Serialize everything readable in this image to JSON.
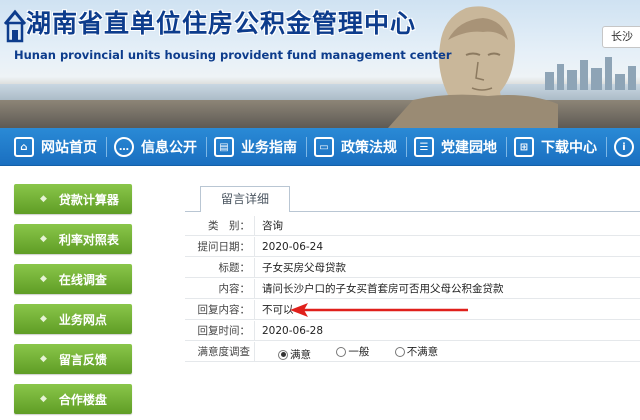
{
  "header": {
    "title_cn": "湖南省直单位住房公积金管理中心",
    "title_en": "Hunan provincial units housing provident fund management center",
    "city": "长沙"
  },
  "nav": {
    "items": [
      {
        "label": "网站首页",
        "icon": "home-icon"
      },
      {
        "label": "信息公开",
        "icon": "chat-icon"
      },
      {
        "label": "业务指南",
        "icon": "book-icon"
      },
      {
        "label": "政策法规",
        "icon": "doc-icon"
      },
      {
        "label": "党建园地",
        "icon": "party-icon"
      },
      {
        "label": "下载中心",
        "icon": "grid-icon"
      },
      {
        "label": "",
        "icon": "info-icon"
      }
    ]
  },
  "sidebar": {
    "items": [
      {
        "label": "贷款计算器"
      },
      {
        "label": "利率对照表"
      },
      {
        "label": "在线调查"
      },
      {
        "label": "业务网点"
      },
      {
        "label": "留言反馈"
      },
      {
        "label": "合作楼盘"
      }
    ]
  },
  "detail": {
    "tab": "留言详细",
    "rows": [
      {
        "label": "类　别：",
        "value": "咨询"
      },
      {
        "label": "提问日期：",
        "value": "2020-06-24"
      },
      {
        "label": "标题：",
        "value": "子女买房父母贷款"
      },
      {
        "label": "内容：",
        "value": "请问长沙户口的子女买首套房可否用父母公积金贷款"
      },
      {
        "label": "回复内容：",
        "value": "不可以"
      },
      {
        "label": "回复时间：",
        "value": "2020-06-28"
      }
    ],
    "satisfaction": {
      "label": "满意度调查",
      "options": [
        "满意",
        "一般",
        "不满意"
      ],
      "selected": "满意"
    }
  },
  "colors": {
    "nav_blue": "#1a6fc0",
    "sidebar_green": "#6aab2e",
    "title_blue": "#0d3c8c",
    "annotation_red": "#e0201b"
  }
}
